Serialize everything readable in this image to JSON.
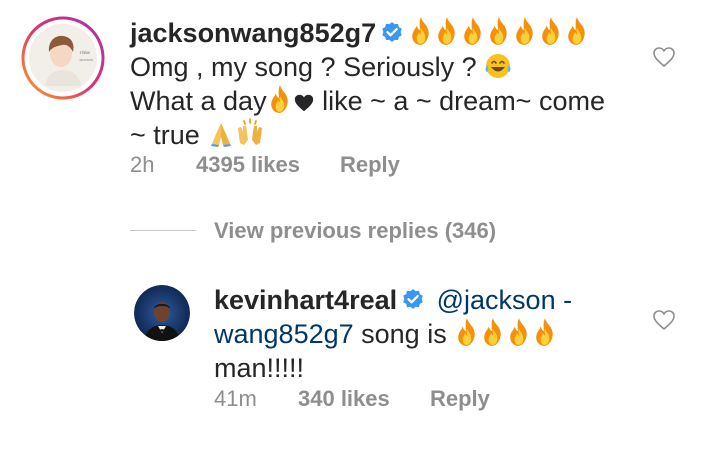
{
  "comments": [
    {
      "username": "jacksonwang852g7",
      "text_line1": "Omg , my song ? Seriously ?",
      "text_line2_a": "What a day",
      "text_line2_b": " like ~ a ~ dream~ come",
      "text_line3": "~ true",
      "time": "2h",
      "likes": "4395 likes",
      "reply": "Reply",
      "avatar_text_a": "ITEM",
      "avatar_text_b": "JACKSON"
    },
    {
      "username": "kevinhart4real",
      "mention_a": "@jackson -",
      "mention_b": "wang852g7",
      "text_b": " song is",
      "text_c": "man!!!!!",
      "time": "41m",
      "likes": "340 likes",
      "reply": "Reply"
    }
  ],
  "view_replies": "View previous replies (346)",
  "icons": {
    "verified": "verified-badge-icon",
    "fire": "fire-emoji-icon",
    "heart": "heart-outline-icon",
    "tears_of_joy": "tears-of-joy-emoji-icon",
    "black_heart": "black-heart-emoji-icon",
    "folded_hands": "folded-hands-emoji-icon",
    "raising_hands": "raising-hands-emoji-icon"
  },
  "colors": {
    "verified_blue": "#3897f0",
    "mention_blue": "#00376b",
    "meta_gray": "#8e8e8e",
    "story_ring": "#e1306c"
  }
}
